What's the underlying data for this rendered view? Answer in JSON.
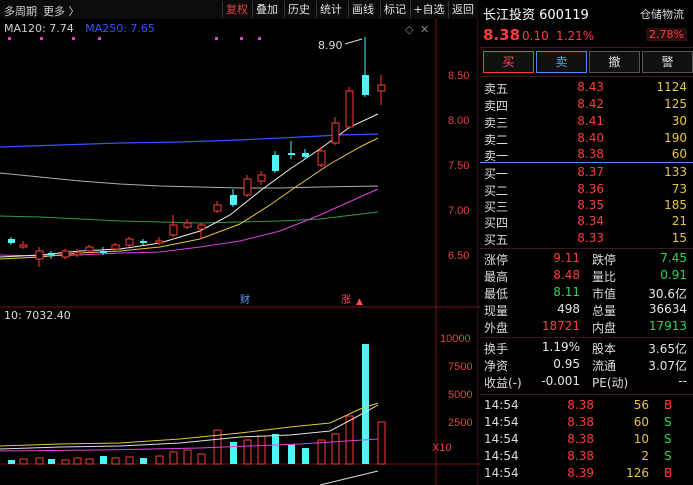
{
  "toolbar": {
    "period": "多周期",
    "more": "更多 〉",
    "buttons": [
      "复权",
      "叠加",
      "历史",
      "统计",
      "画线",
      "标记",
      "+自选",
      "返回"
    ]
  },
  "ma": {
    "ma120": "MA120: 7.74",
    "ma250": "MA250: 7.65"
  },
  "chart": {
    "high_label": "8.90",
    "y_ticks": [
      "8.50",
      "8.00",
      "7.50",
      "7.00",
      "6.50"
    ],
    "markers": [
      "财",
      "涨"
    ],
    "volume_label": "10: 7032.40",
    "vol_ticks": [
      "10000",
      "7500",
      "5000",
      "2500"
    ],
    "vol_unit": "X10"
  },
  "stock": {
    "name": "长江投资 600119",
    "price": "8.38",
    "change": "0.10",
    "pct": "1.21%",
    "tag": "仓储物流",
    "tag_pct": "2.78%"
  },
  "actions": {
    "buy": "买",
    "sell": "卖",
    "cancel": "撤",
    "alert": "警"
  },
  "orderbook": {
    "asks": [
      {
        "label": "卖五",
        "price": "8.43",
        "vol": "1124"
      },
      {
        "label": "卖四",
        "price": "8.42",
        "vol": "125"
      },
      {
        "label": "卖三",
        "price": "8.41",
        "vol": "30"
      },
      {
        "label": "卖二",
        "price": "8.40",
        "vol": "190"
      },
      {
        "label": "卖一",
        "price": "8.38",
        "vol": "60"
      }
    ],
    "bids": [
      {
        "label": "买一",
        "price": "8.37",
        "vol": "133"
      },
      {
        "label": "买二",
        "price": "8.36",
        "vol": "73"
      },
      {
        "label": "买三",
        "price": "8.35",
        "vol": "185"
      },
      {
        "label": "买四",
        "price": "8.34",
        "vol": "21"
      },
      {
        "label": "买五",
        "price": "8.33",
        "vol": "15"
      }
    ]
  },
  "stats": [
    {
      "l1": "涨停",
      "v1": "9.11",
      "c1": "red",
      "l2": "跌停",
      "v2": "7.45",
      "c2": "green"
    },
    {
      "l1": "最高",
      "v1": "8.48",
      "c1": "red",
      "l2": "量比",
      "v2": "0.91",
      "c2": "green"
    },
    {
      "l1": "最低",
      "v1": "8.11",
      "c1": "green",
      "l2": "市值",
      "v2": "30.6亿",
      "c2": "white"
    },
    {
      "l1": "现量",
      "v1": "498",
      "c1": "white",
      "l2": "总量",
      "v2": "36634",
      "c2": "white"
    },
    {
      "l1": "外盘",
      "v1": "18721",
      "c1": "red",
      "l2": "内盘",
      "v2": "17913",
      "c2": "green"
    },
    {
      "l1": "换手",
      "v1": "1.19%",
      "c1": "white",
      "l2": "股本",
      "v2": "3.65亿",
      "c2": "white"
    },
    {
      "l1": "净资",
      "v1": "0.95",
      "c1": "white",
      "l2": "流通",
      "v2": "3.07亿",
      "c2": "white"
    },
    {
      "l1": "收益(-)",
      "v1": "-0.001",
      "c1": "white",
      "l2": "PE(动)",
      "v2": "--",
      "c2": "white"
    }
  ],
  "ticks": [
    {
      "time": "14:54",
      "price": "8.38",
      "vol": "56",
      "side": "B",
      "sc": "red"
    },
    {
      "time": "14:54",
      "price": "8.38",
      "vol": "60",
      "side": "S",
      "sc": "green"
    },
    {
      "time": "14:54",
      "price": "8.38",
      "vol": "10",
      "side": "S",
      "sc": "green"
    },
    {
      "time": "14:54",
      "price": "8.38",
      "vol": "2",
      "side": "S",
      "sc": "green"
    },
    {
      "time": "14:54",
      "price": "8.39",
      "vol": "126",
      "side": "B",
      "sc": "red"
    }
  ],
  "colors": {
    "up": "#ff3b3b",
    "down": "#29d65c",
    "cyan": "#4ff5f5",
    "ma_blue": "#3355ff"
  }
}
